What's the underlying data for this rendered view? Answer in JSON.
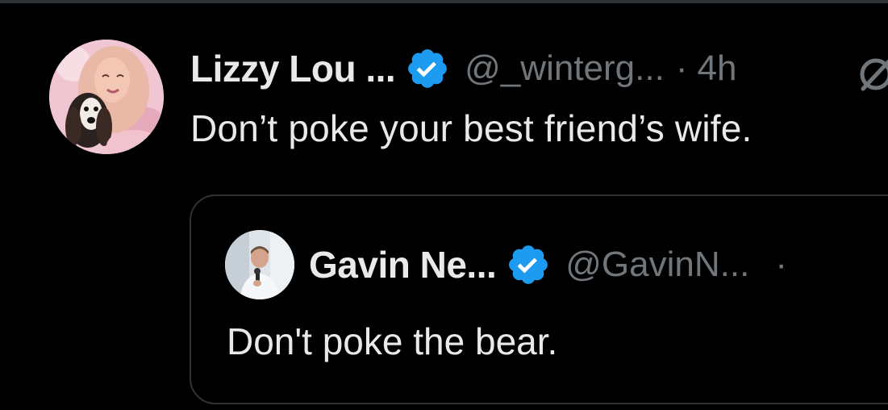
{
  "tweet": {
    "display_name": "Lizzy Lou ...",
    "verified_icon": "verified-badge-icon",
    "handle": "@_winterg...",
    "separator": "·",
    "timestamp": "4h",
    "text": "Don’t poke your best friend’s wife.",
    "grok_icon": "grok-icon"
  },
  "quote": {
    "display_name": "Gavin Ne...",
    "verified_icon": "verified-badge-icon",
    "handle": "@GavinN...",
    "separator": "·",
    "text": "Don't poke the bear."
  },
  "colors": {
    "background": "#000000",
    "primary_text": "#e7e9ea",
    "secondary_text": "#71767b",
    "verified_blue": "#1d9bf0",
    "border": "#2f3336"
  }
}
